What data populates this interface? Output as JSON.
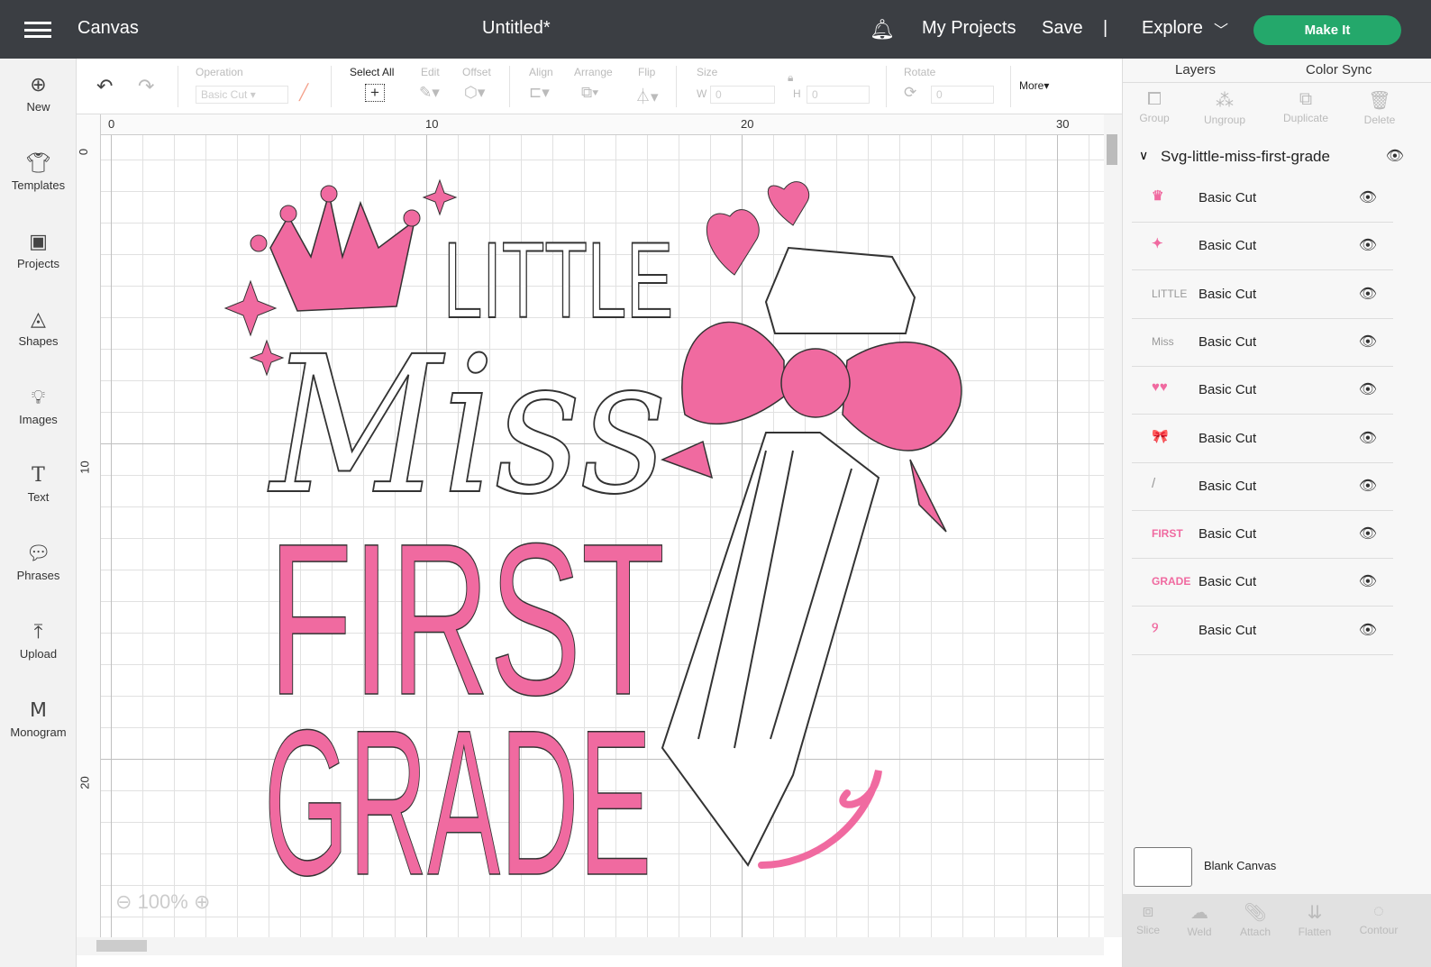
{
  "topbar": {
    "app": "Canvas",
    "title": "Untitled*",
    "my_projects": "My Projects",
    "save": "Save",
    "divider": "|",
    "explore": "Explore",
    "make_it": "Make It"
  },
  "sidebar": [
    {
      "label": "New",
      "icon": "plus-circle-icon"
    },
    {
      "label": "Templates",
      "icon": "shirt-icon"
    },
    {
      "label": "Projects",
      "icon": "projects-icon"
    },
    {
      "label": "Shapes",
      "icon": "shapes-icon"
    },
    {
      "label": "Images",
      "icon": "lightbulb-icon"
    },
    {
      "label": "Text",
      "icon": "text-icon"
    },
    {
      "label": "Phrases",
      "icon": "speech-icon"
    },
    {
      "label": "Upload",
      "icon": "upload-icon"
    },
    {
      "label": "Monogram",
      "icon": "monogram-icon"
    }
  ],
  "toolbar": {
    "operation": "Operation",
    "operation_value": "Basic Cut",
    "select_all": "Select All",
    "edit": "Edit",
    "offset": "Offset",
    "align": "Align",
    "arrange": "Arrange",
    "flip": "Flip",
    "size": "Size",
    "w": "W",
    "w_value": "0",
    "h": "H",
    "h_value": "0",
    "rotate": "Rotate",
    "rotate_value": "0",
    "more": "More▾"
  },
  "ruler": {
    "top": [
      "0",
      "10",
      "20",
      "30"
    ],
    "left": [
      "0",
      "10",
      "20"
    ]
  },
  "zoom": {
    "value": "100%"
  },
  "design": {
    "little": "LITTLE",
    "miss": "Miss",
    "first": "FIRST",
    "grade": "GRADE",
    "pink": "#f06aa0"
  },
  "panel": {
    "tab_layers": "Layers",
    "tab_color_sync": "Color Sync",
    "actions": [
      "Group",
      "Ungroup",
      "Duplicate",
      "Delete"
    ],
    "group_name": "Svg-little-miss-first-grade",
    "layers": [
      {
        "thumb": "♛",
        "label": "Basic Cut"
      },
      {
        "thumb": "✦",
        "label": "Basic Cut"
      },
      {
        "thumb": "LITTLE",
        "label": "Basic Cut"
      },
      {
        "thumb": "Miss",
        "label": "Basic Cut"
      },
      {
        "thumb": "♥♥",
        "label": "Basic Cut"
      },
      {
        "thumb": "🎀",
        "label": "Basic Cut"
      },
      {
        "thumb": "/",
        "label": "Basic Cut"
      },
      {
        "thumb": "FIRST",
        "label": "Basic Cut"
      },
      {
        "thumb": "GRADE",
        "label": "Basic Cut"
      },
      {
        "thumb": "୨",
        "label": "Basic Cut"
      }
    ],
    "blank_canvas": "Blank Canvas",
    "bottom_actions": [
      "Slice",
      "Weld",
      "Attach",
      "Flatten",
      "Contour"
    ]
  }
}
